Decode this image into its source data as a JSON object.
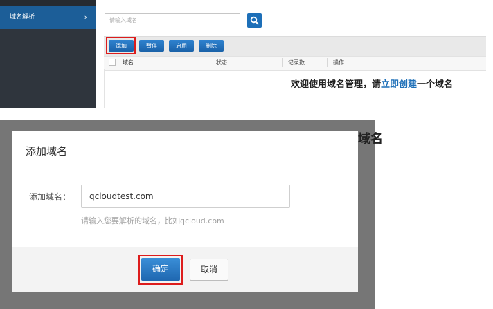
{
  "sidebar": {
    "items": [
      {
        "label": "域名解析",
        "icon": "chevron-right-icon"
      }
    ]
  },
  "search": {
    "placeholder": "请输入域名",
    "button_icon": "search-icon"
  },
  "toolbar": {
    "add_label": "添加",
    "pause_label": "暂停",
    "enable_label": "启用",
    "delete_label": "删除"
  },
  "table": {
    "columns": [
      "域名",
      "状态",
      "记录数",
      "操作"
    ]
  },
  "welcome": {
    "prefix": "欢迎使用域名管理，请",
    "link": "立即创建",
    "suffix": "一个域名"
  },
  "background_peek": "域名",
  "dialog": {
    "title": "添加域名",
    "field_label": "添加域名：",
    "field_value": "qcloudtest.com",
    "hint": "请输入您要解析的域名，比如qcloud.com",
    "ok_label": "确定",
    "cancel_label": "取消"
  },
  "colors": {
    "accent": "#1d6fb8",
    "highlight": "#dd1c1c",
    "sidebar_bg": "#2f353d",
    "overlay": "#767676"
  }
}
